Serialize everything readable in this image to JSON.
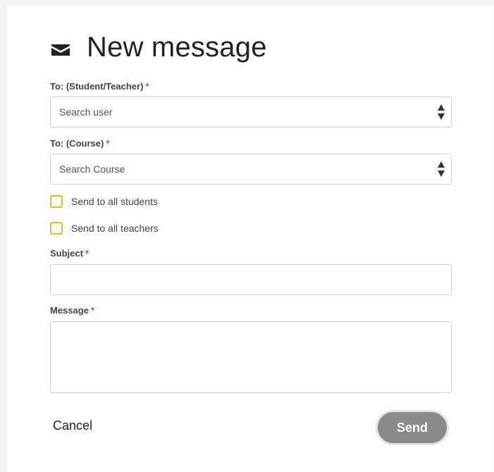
{
  "dialog": {
    "title": "New message"
  },
  "fields": {
    "to_user": {
      "label": "To: (Student/Teacher)",
      "required_mark": "*",
      "placeholder": "Search user"
    },
    "to_course": {
      "label": "To: (Course)",
      "required_mark": "*",
      "placeholder": "Search Course"
    },
    "send_all_students": {
      "label": "Send to all students",
      "checked": false
    },
    "send_all_teachers": {
      "label": "Send to all teachers",
      "checked": false
    },
    "subject": {
      "label": "Subject",
      "required_mark": "*",
      "value": ""
    },
    "message": {
      "label": "Message",
      "required_mark": "*",
      "value": ""
    }
  },
  "actions": {
    "cancel_label": "Cancel",
    "send_label": "Send"
  },
  "colors": {
    "required": "#e8473e",
    "checkbox_border": "#f2b727",
    "send_button": "#8a8a8a"
  }
}
